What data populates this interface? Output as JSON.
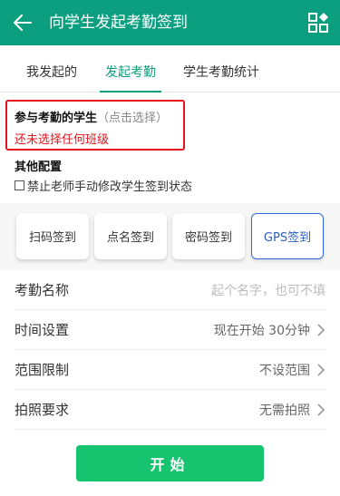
{
  "header": {
    "title": "向学生发起考勤签到"
  },
  "tabs": [
    {
      "label": "我发起的"
    },
    {
      "label": "发起考勤"
    },
    {
      "label": "学生考勤统计"
    }
  ],
  "participants": {
    "label": "参与考勤的学生",
    "hint": "（点击选择）",
    "warning": "还未选择任何班级"
  },
  "other_config": {
    "title": "其他配置",
    "checkbox_label": "禁止老师手动修改学生签到状态"
  },
  "signin_types": [
    {
      "label": "扫码签到"
    },
    {
      "label": "点名签到"
    },
    {
      "label": "密码签到"
    },
    {
      "label": "GPS签到"
    }
  ],
  "form": {
    "name_label": "考勤名称",
    "name_placeholder": "起个名字，也可不填",
    "time_label": "时间设置",
    "time_value": "现在开始 30分钟",
    "range_label": "范围限制",
    "range_value": "不设范围",
    "photo_label": "拍照要求",
    "photo_value": "无需拍照"
  },
  "start_button": "开始",
  "colors": {
    "brand": "#0c9f7f",
    "alert": "#e3141c",
    "start": "#16c36e",
    "selected_border": "#2f6bd4"
  }
}
